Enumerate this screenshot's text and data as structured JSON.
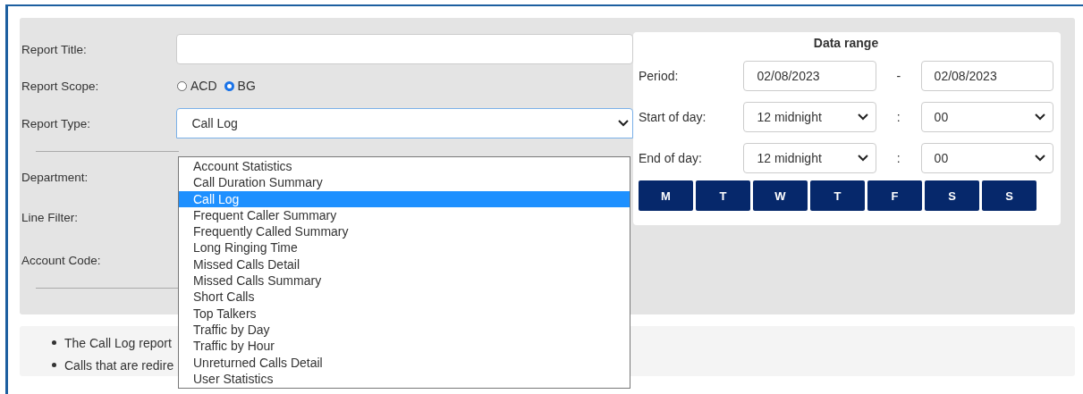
{
  "form": {
    "title_label": "Report Title:",
    "scope_label": "Report Scope:",
    "scope_options": [
      {
        "label": "ACD",
        "selected": false
      },
      {
        "label": "BG",
        "selected": true
      }
    ],
    "type_label": "Report Type:",
    "type_value": "Call Log",
    "type_options": [
      {
        "label": "Account Statistics",
        "selected": false
      },
      {
        "label": "Call Duration Summary",
        "selected": false
      },
      {
        "label": "Call Log",
        "selected": true
      },
      {
        "label": "Frequent Caller Summary",
        "selected": false
      },
      {
        "label": "Frequently Called Summary",
        "selected": false
      },
      {
        "label": "Long Ringing Time",
        "selected": false
      },
      {
        "label": "Missed Calls Detail",
        "selected": false
      },
      {
        "label": "Missed Calls Summary",
        "selected": false
      },
      {
        "label": "Short Calls",
        "selected": false
      },
      {
        "label": "Top Talkers",
        "selected": false
      },
      {
        "label": "Traffic by Day",
        "selected": false
      },
      {
        "label": "Traffic by Hour",
        "selected": false
      },
      {
        "label": "Unreturned Calls Detail",
        "selected": false
      },
      {
        "label": "User Statistics",
        "selected": false
      }
    ],
    "department_label": "Department:",
    "line_filter_label": "Line Filter:",
    "account_code_label": "Account Code:"
  },
  "data_range": {
    "title": "Data range",
    "period_label": "Period:",
    "period_from": "02/08/2023",
    "separator": "-",
    "period_to": "02/08/2023",
    "start_label": "Start of day:",
    "start_hour": "12 midnight",
    "colon_start": ":",
    "start_minute": "00",
    "end_label": "End of day:",
    "end_hour": "12 midnight",
    "colon_end": ":",
    "end_minute": "00",
    "days": [
      "M",
      "T",
      "W",
      "T",
      "F",
      "S",
      "S"
    ]
  },
  "notes": [
    "The Call Log report",
    "Calls that are redire"
  ]
}
